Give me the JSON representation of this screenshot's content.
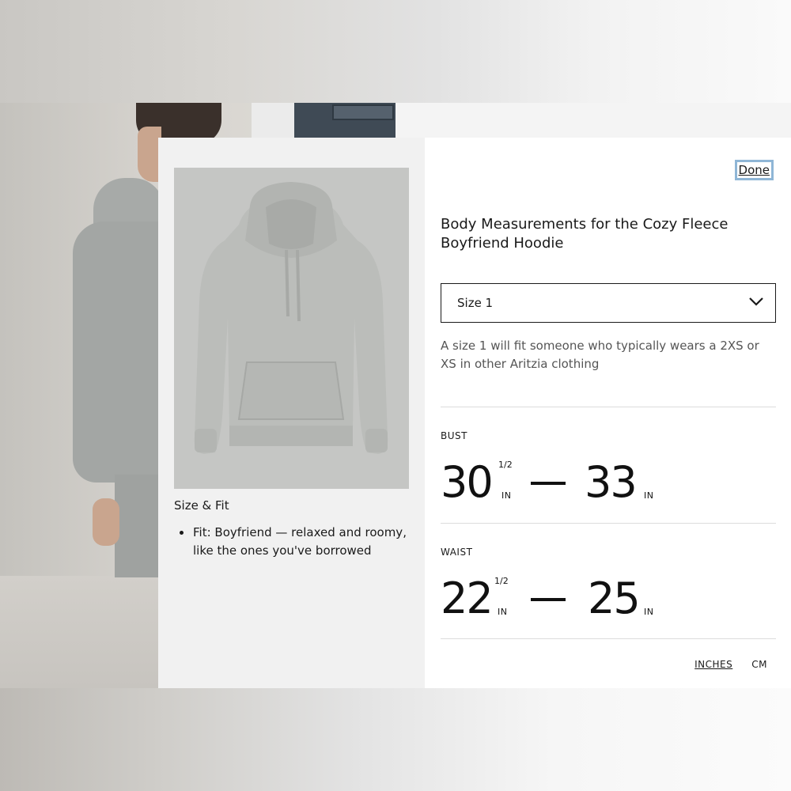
{
  "modal": {
    "done_label": "Done",
    "title": "Body Measurements for the Cozy Fleece Boyfriend Hoodie",
    "size_select": {
      "value": "Size 1",
      "icon": "chevron-down-icon"
    },
    "size_note": "A size 1 will fit someone who typically wears a 2XS or XS in other Aritzia clothing",
    "measurements": [
      {
        "label": "BUST",
        "min": "30",
        "min_fraction": "1/2",
        "min_unit": "IN",
        "max": "33",
        "max_unit": "IN"
      },
      {
        "label": "WAIST",
        "min": "22",
        "min_fraction": "1/2",
        "min_unit": "IN",
        "max": "25",
        "max_unit": "IN"
      }
    ],
    "units": {
      "inches": "INCHES",
      "cm": "CM",
      "selected": "INCHES"
    }
  },
  "size_fit": {
    "title": "Size & Fit",
    "items": [
      "Fit: Boyfriend — relaxed and roomy, like the ones you've borrowed"
    ]
  },
  "colors": {
    "modal_left_bg": "#f1f1f1",
    "modal_right_bg": "#ffffff",
    "focus_ring": "#8fb6d6",
    "text": "#1a1a1a",
    "muted_text": "#555555"
  }
}
